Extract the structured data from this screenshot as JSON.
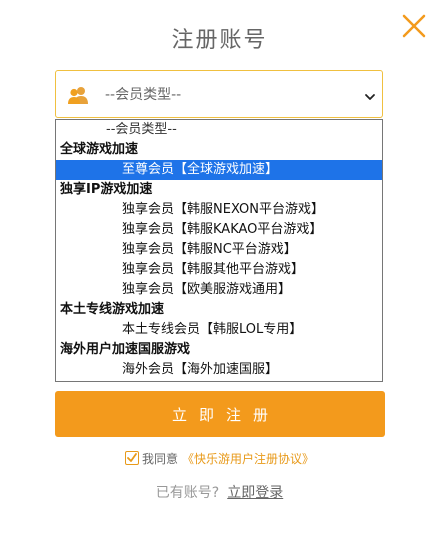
{
  "header": {
    "title": "注册账号"
  },
  "member_type": {
    "selected_value": "--会员类型--",
    "options": [
      {
        "kind": "placeholder",
        "label": "--会员类型--"
      },
      {
        "kind": "group",
        "label": "全球游戏加速"
      },
      {
        "kind": "item",
        "label": "至尊会员【全球游戏加速】",
        "selected": true
      },
      {
        "kind": "group",
        "label": "独享IP游戏加速"
      },
      {
        "kind": "item",
        "label": "独享会员【韩服NEXON平台游戏】"
      },
      {
        "kind": "item",
        "label": "独享会员【韩服KAKAO平台游戏】"
      },
      {
        "kind": "item",
        "label": "独享会员【韩服NC平台游戏】"
      },
      {
        "kind": "item",
        "label": "独享会员【韩服其他平台游戏】"
      },
      {
        "kind": "item",
        "label": "独享会员【欧美服游戏通用】"
      },
      {
        "kind": "group",
        "label": "本土专线游戏加速"
      },
      {
        "kind": "item",
        "label": "本土专线会员【韩服LOL专用】"
      },
      {
        "kind": "group",
        "label": "海外用户加速国服游戏"
      },
      {
        "kind": "item",
        "label": "海外会员【海外加速国服】"
      }
    ]
  },
  "register_button": {
    "label": "立即注册"
  },
  "agreement": {
    "checked": true,
    "prefix": "我同意",
    "link_text": "《快乐游用户注册协议》"
  },
  "login": {
    "prompt": "已有账号?",
    "link_text": "立即登录"
  },
  "colors": {
    "accent": "#f39a1c",
    "select_border": "#f0c040",
    "highlight": "#1e73e8"
  },
  "icons": {
    "close": "close-icon",
    "member": "user-group-icon",
    "dropdown": "chevron-down-icon",
    "check": "check-icon"
  }
}
